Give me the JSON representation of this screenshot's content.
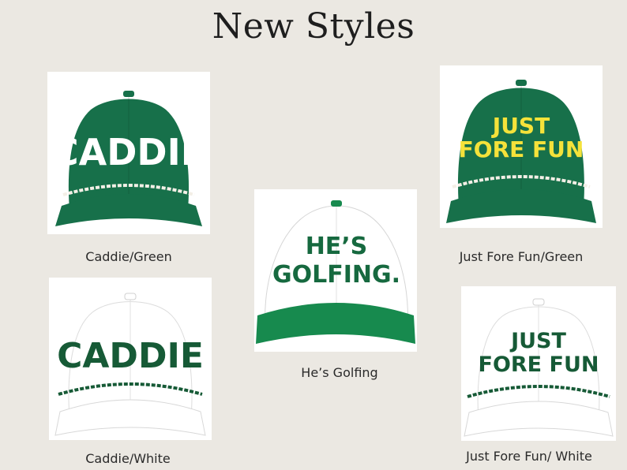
{
  "page": {
    "title": "New Styles"
  },
  "products": [
    {
      "caption": "Caddie/Green",
      "hat_text_lines": [
        "CADDIE"
      ],
      "crown_color": "#17704a",
      "brim_color": "#17704a",
      "text_color": "#ffffff",
      "rope_color": "#f3efe6",
      "button_color": "#17704a"
    },
    {
      "caption": "Just Fore Fun/Green",
      "hat_text_lines": [
        "JUST",
        "FORE FUN"
      ],
      "crown_color": "#17704a",
      "brim_color": "#17704a",
      "text_color": "#f5e23a",
      "rope_color": "#f3efe6",
      "button_color": "#17704a"
    },
    {
      "caption": "He’s Golfing",
      "hat_text_lines": [
        "HE’S",
        "GOLFING."
      ],
      "crown_color": "#ffffff",
      "brim_color": "#178a4e",
      "text_color": "#16693f",
      "rope_color": "none",
      "button_color": "#178a4e"
    },
    {
      "caption": "Caddie/White",
      "hat_text_lines": [
        "CADDIE"
      ],
      "crown_color": "#ffffff",
      "brim_color": "#ffffff",
      "text_color": "#165a36",
      "rope_color": "#165a36",
      "button_color": "#ffffff"
    },
    {
      "caption": "Just Fore Fun/ White",
      "hat_text_lines": [
        "JUST",
        "FORE FUN"
      ],
      "crown_color": "#ffffff",
      "brim_color": "#ffffff",
      "text_color": "#165a36",
      "rope_color": "#165a36",
      "button_color": "#ffffff"
    }
  ]
}
